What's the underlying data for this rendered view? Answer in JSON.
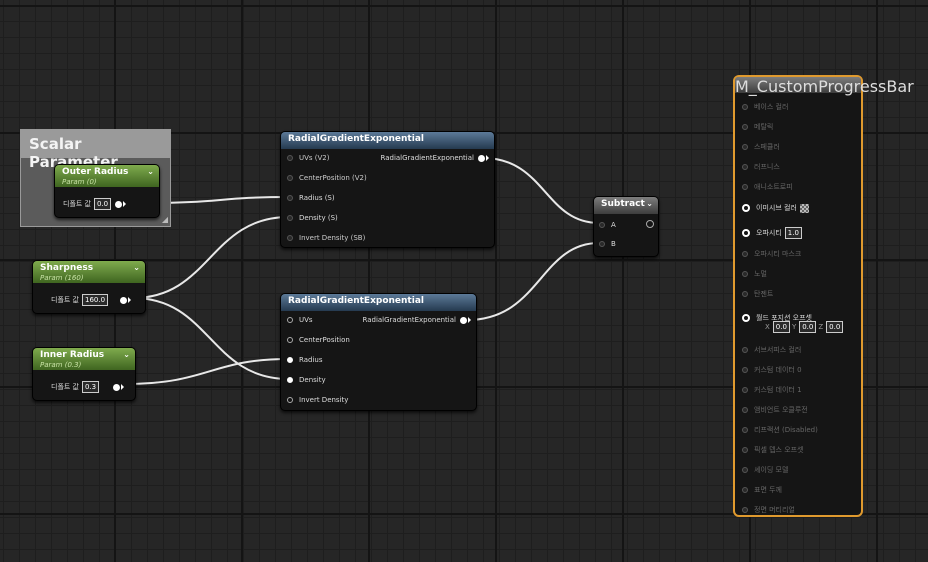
{
  "scalar_comment": {
    "title": "Scalar Parameter"
  },
  "outer_radius": {
    "title": "Outer Radius",
    "subtitle": "Param (0)",
    "value_label": "디폴트 값",
    "value": "0.0"
  },
  "sharpness": {
    "title": "Sharpness",
    "subtitle": "Param (160)",
    "value_label": "디폴트 값",
    "value": "160.0"
  },
  "inner_radius": {
    "title": "Inner Radius",
    "subtitle": "Param (0.3)",
    "value_label": "디폴트 값",
    "value": "0.3"
  },
  "rge1": {
    "title": "RadialGradientExponential",
    "output": "RadialGradientExponential",
    "inputs": [
      "UVs (V2)",
      "CenterPosition (V2)",
      "Radius (S)",
      "Density (S)",
      "Invert Density (SB)"
    ]
  },
  "rge2": {
    "title": "RadialGradientExponential",
    "output": "RadialGradientExponential",
    "inputs": [
      "UVs",
      "CenterPosition",
      "Radius",
      "Density",
      "Invert Density"
    ]
  },
  "subtract": {
    "title": "Subtract",
    "inputs": [
      "A",
      "B"
    ]
  },
  "material": {
    "title": "M_CustomProgressBar",
    "pins": [
      "베이스 컬러",
      "메탈릭",
      "스페큘러",
      "러프니스",
      "애니소트로피",
      "이미시브 컬러",
      "오파시티",
      "오파시티 마스크",
      "노멀",
      "탄젠트",
      "월드 포지션 오프셋",
      "서브서피스 컬러",
      "커스텀 데이터 0",
      "커스텀 데이터 1",
      "앰비언트 오클루전",
      "리프랙션 (Disabled)",
      "픽셀 뎁스 오프셋",
      "셰이딩 모델",
      "표면 두께",
      "정면 머티리얼"
    ],
    "opacity_value": "1.0",
    "wpo": {
      "x_label": "X",
      "x": "0.0",
      "y_label": "Y",
      "y": "0.0",
      "z_label": "Z",
      "z": "0.0"
    }
  }
}
